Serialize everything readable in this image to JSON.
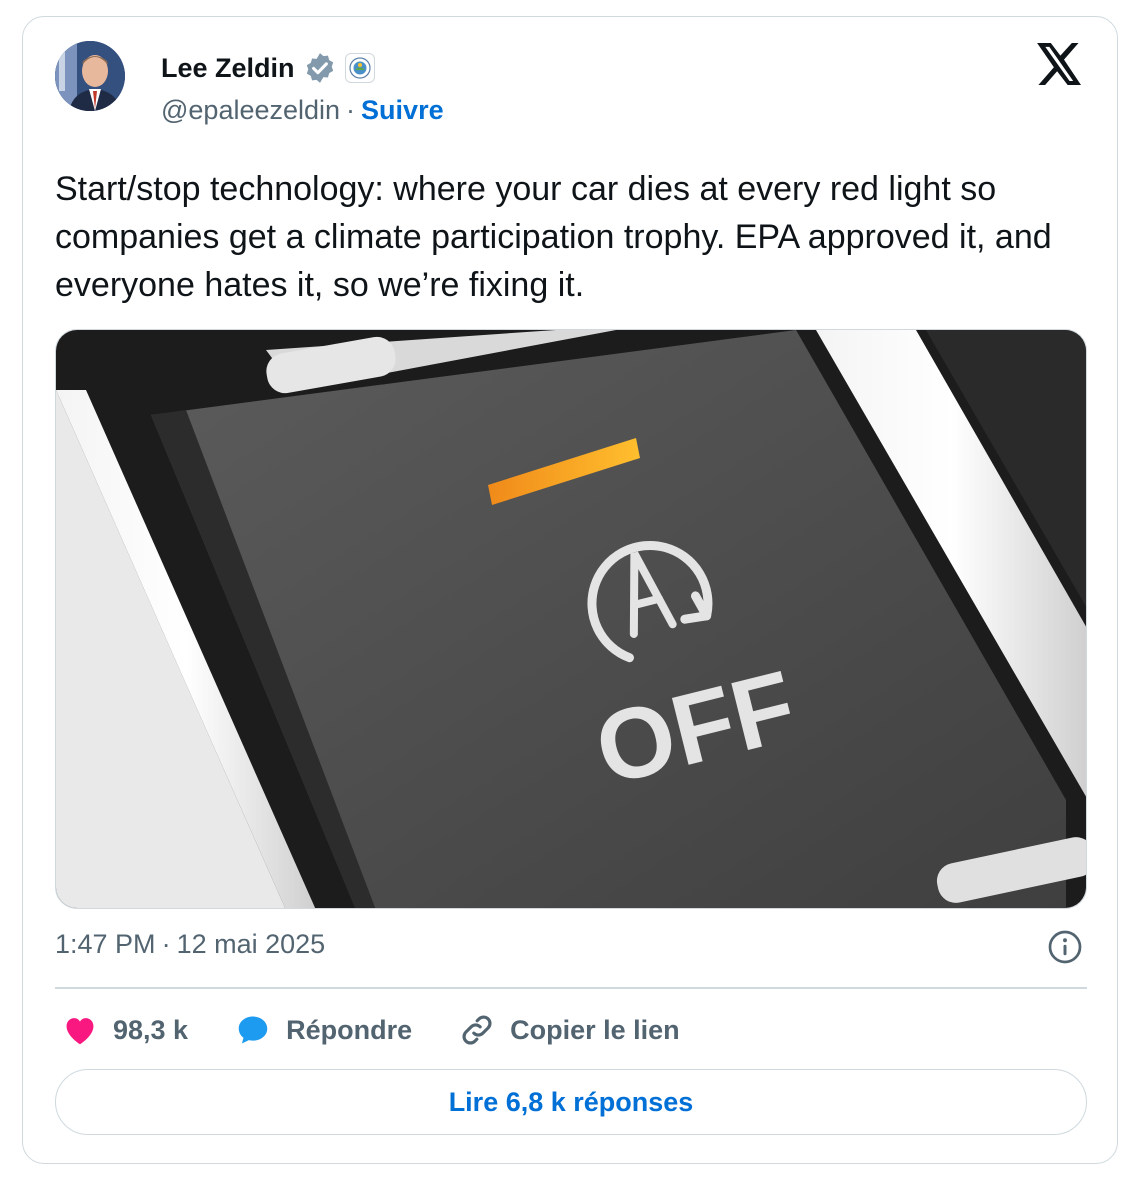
{
  "author": {
    "name": "Lee Zeldin",
    "handle": "@epaleezeldin",
    "separator": "·",
    "follow_label": "Suivre"
  },
  "tweet": {
    "text": "Start/stop technology: where your car dies at every red light so companies get a climate participation trophy. EPA approved it, and everyone hates it, so we’re fixing it.",
    "time": "1:47 PM",
    "separator": "·",
    "date": "12 mai 2025"
  },
  "media": {
    "button_label": "OFF"
  },
  "actions": {
    "likes": "98,3 k",
    "reply_label": "Répondre",
    "copy_label": "Copier le lien"
  },
  "read_replies_label": "Lire 6,8 k réponses",
  "colors": {
    "link_blue": "#006fd6",
    "like_pink": "#f91880",
    "reply_blue": "#1d9bf0",
    "border": "#cfd9de",
    "secondary_text": "#536471"
  },
  "icons": {
    "verified": "verified-badge-icon",
    "affiliation": "epa-seal-icon",
    "platform": "x-logo-icon",
    "info": "info-icon",
    "like": "heart-icon",
    "reply": "speech-bubble-icon",
    "copy": "link-icon"
  }
}
